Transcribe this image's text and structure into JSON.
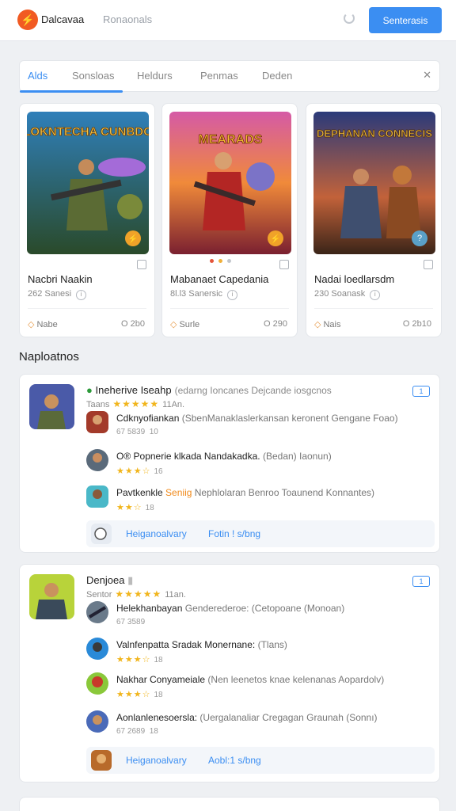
{
  "header": {
    "app_name": "Dalcavaa",
    "search_placeholder": "Ronaonals",
    "cta_label": "Senterasis",
    "colors": {
      "accent": "#3b8ef2",
      "brand": "#f15a22"
    }
  },
  "tabs": {
    "items": [
      "Alds",
      "Sonsloas",
      "Heldurs",
      "Penmas",
      "Deden"
    ],
    "active": 0,
    "close_icon": "close-icon"
  },
  "featured": [
    {
      "title": "Nacbri Naakin",
      "art_text": "SLOKNTECHA CUNBDOS",
      "stats": "262",
      "stats_label": "Sanesi",
      "mode": "Nabe",
      "count": "O 2b0"
    },
    {
      "title": "Mabanaet Capedania",
      "art_text": "MEARADS",
      "stats": "8l.l3",
      "stats_label": "Sanersic",
      "mode": "Surle",
      "count": "O 290"
    },
    {
      "title": "Nadai loedlarsdm",
      "art_text": "DEPHANAN CONNECIS",
      "stats": "230",
      "stats_label": "Soanask",
      "mode": "Nais",
      "count": "O 2b10"
    }
  ],
  "section_title": "Naploatnos",
  "lists": [
    {
      "title": "Ineherive Iseahp",
      "subtitle": "(edarng Ioncanes Dejcande iosgcnos",
      "rating_label": "Taans",
      "rating": "4.5 stars",
      "rating_value": "11An.",
      "badge": "1",
      "rows": [
        {
          "title": "Cdknyofiankan",
          "detail": "(SbenManaklaslerkansan keronent Gengane Foao)",
          "meta": "67 5839",
          "meta2": "10",
          "stars": 0
        },
        {
          "title": "O® Popnerie klkada Nandakadka.",
          "detail": "(Bedan) Iaonun)",
          "meta": "",
          "meta2": "16",
          "stars": 3
        },
        {
          "title": "Pavtkenkle",
          "highlight": "Seniig",
          "detail": "Nephlolaran Benroo Toaunend Konnantes)",
          "meta": "",
          "meta2": "18",
          "stars": 2
        }
      ],
      "footer": {
        "link1": "Heiganoalvary",
        "link2": "Fotin ! s/bng"
      }
    },
    {
      "title": "Denjoea",
      "subtitle": "",
      "rating_label": "Sentor",
      "rating": "4.5 stars",
      "rating_value": "11an.",
      "badge": "1",
      "rows": [
        {
          "title": "Helekhanbayan",
          "detail": "Genderederoe: (Cetopoane (Monoan)",
          "meta": "67 3589",
          "meta2": "",
          "stars": 0
        },
        {
          "title": "Valnfenpatta Sradak Monernane:",
          "detail": "(Tlans)",
          "meta": "",
          "meta2": "18",
          "stars": 3
        },
        {
          "title": "Nakhar Conyameiale",
          "detail": "(Nen leenetos knae kelenanas Aopardolv)",
          "meta": "",
          "meta2": "18",
          "stars": 3
        },
        {
          "title": "Aonlanlenesoersla:",
          "detail": "(Uergalanaliar Cregagan Graunah (Sonnı)",
          "meta": "67 2689",
          "meta2": "18",
          "stars": 0
        }
      ],
      "footer": {
        "link1": "Heiganoalvary",
        "link2": "Aobl:1 s/bng"
      }
    }
  ]
}
